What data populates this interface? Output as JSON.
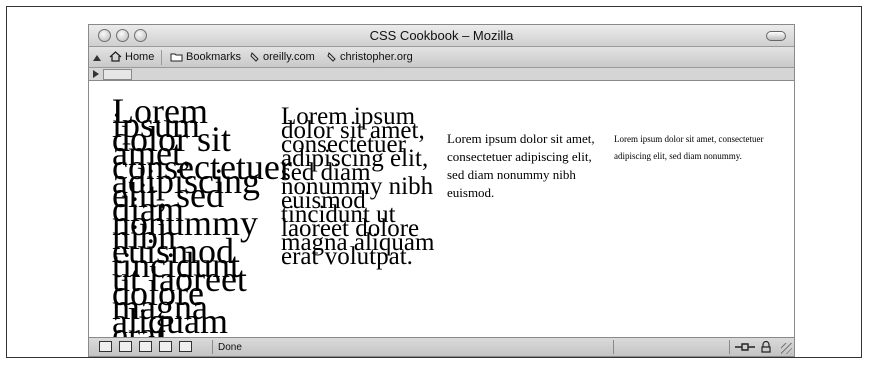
{
  "window": {
    "title": "CSS Cookbook – Mozilla"
  },
  "toolbar": {
    "home_label": "Home",
    "bookmarks_label": "Bookmarks",
    "link1_label": "oreilly.com",
    "link2_label": "christopher.org"
  },
  "content": {
    "paragraphs": [
      "Lorem ipsum dolor sit amet, consectetuer adipiscing elit, sed diam nonummy nibh euismod tincidunt ut laoreet dolore magna aliquam erat volutpat.",
      "Lorem ipsum dolor sit amet, consectetuer adipiscing elit, sed diam nonummy nibh euismod tincidunt ut laoreet dolore magna aliquam erat volutpat.",
      "Lorem ipsum dolor sit amet, consectetuer adipiscing elit, sed diam nonummy nibh euismod.",
      "Lorem ipsum dolor sit amet, consectetuer adipiscing elit, sed diam nonummy."
    ]
  },
  "statusbar": {
    "status_text": "Done"
  },
  "icons": {
    "home": "home-icon",
    "bookmarks": "folder-icon",
    "link": "bookmark-link-icon"
  }
}
